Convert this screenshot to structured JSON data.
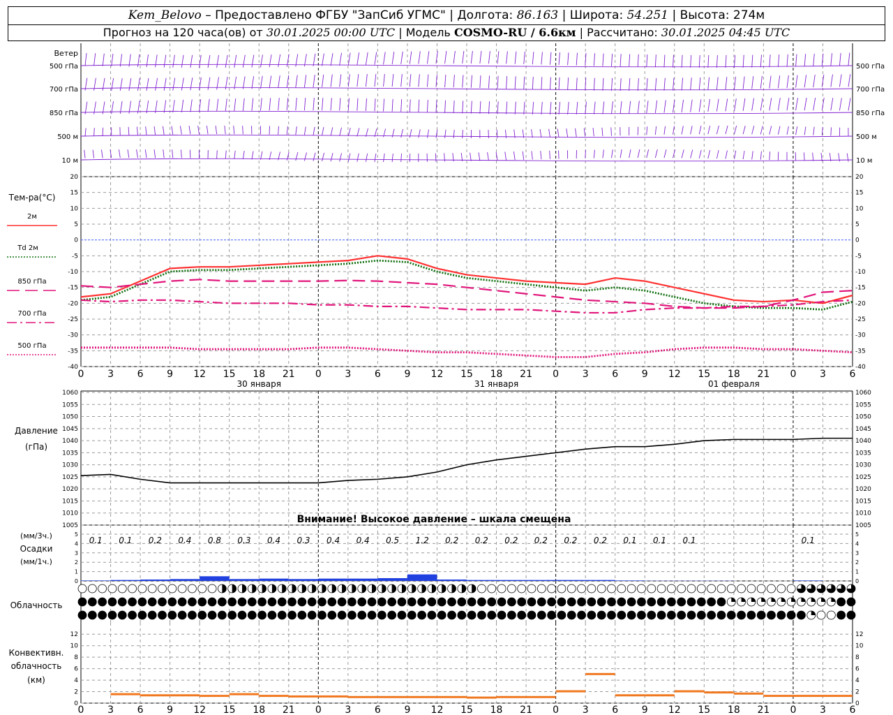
{
  "header": {
    "station": "Kem_Belovo",
    "provider": "– Предоставлено ФГБУ \"ЗапСиб УГМС\"",
    "lon_label": "Долгота:",
    "lon": "86.163",
    "lat_label": "Широта:",
    "lat": "54.251",
    "alt_label": "Высота:",
    "alt": "274м",
    "forecast_label": "Прогноз на 120 часа(ов) от",
    "forecast_time": "30.01.2025 00:00 UTC",
    "model_label": "Модель",
    "model": "COSMO-RU / 6.6км",
    "computed_label": "Рассчитано:",
    "computed_time": "30.01.2025 04:45 UTC",
    "sep": "|"
  },
  "time_axis": {
    "hours": [
      "0",
      "3",
      "6",
      "9",
      "12",
      "15",
      "18",
      "21",
      "0",
      "3",
      "6",
      "9",
      "12",
      "15",
      "18",
      "21",
      "0",
      "3",
      "6",
      "9",
      "12",
      "15",
      "18",
      "21",
      "0",
      "3",
      "6"
    ],
    "dates": [
      "30 января",
      "31 января",
      "01 февраля"
    ]
  },
  "wind_panel": {
    "title": "Ветер",
    "levels": [
      "500 гПа",
      "700 гПа",
      "850 гПа",
      "500 м",
      "10 м"
    ]
  },
  "temp_panel": {
    "title": "Тем-ра(°С)",
    "legend": [
      {
        "label": "2м",
        "color": "#ff3030",
        "dash": "solid"
      },
      {
        "label": "Td 2м",
        "color": "#107010",
        "dash": "dotted"
      },
      {
        "label": "850 гПа",
        "color": "#e0147a",
        "dash": "long-dash"
      },
      {
        "label": "700 гПа",
        "color": "#e0147a",
        "dash": "dash-dot"
      },
      {
        "label": "500 гПа",
        "color": "#e0147a",
        "dash": "dotted"
      }
    ],
    "ticks": [
      "20",
      "15",
      "10",
      "5",
      "0",
      "-5",
      "-10",
      "-15",
      "-20",
      "-25",
      "-30",
      "-35",
      "-40"
    ]
  },
  "pressure_panel": {
    "title": "Давление",
    "unit": "(гПа)",
    "ticks": [
      "1060",
      "1055",
      "1050",
      "1045",
      "1040",
      "1035",
      "1030",
      "1025",
      "1020",
      "1015",
      "1010",
      "1005"
    ],
    "warning": "Внимание! Высокое давление – шкала смещена"
  },
  "precip_panel": {
    "unit3": "(мм/3ч.)",
    "title": "Осадки",
    "unit1": "(мм/1ч.)",
    "ticks": [
      "5",
      "4",
      "3",
      "2",
      "1",
      "0"
    ],
    "labels": [
      "0.1",
      "0.1",
      "0.2",
      "0.4",
      "0.8",
      "0.3",
      "0.4",
      "0.3",
      "0.4",
      "0.4",
      "0.5",
      "1.2",
      "0.2",
      "0.2",
      "0.2",
      "0.2",
      "0.2",
      "0.2",
      "0.1",
      "0.1",
      "0.1",
      "",
      "",
      "",
      "0.1",
      "",
      ""
    ]
  },
  "cloud_panel": {
    "title": "Облачность"
  },
  "conv_panel": {
    "title1": "Конвективн.",
    "title2": "облачность",
    "unit": "(км)",
    "ticks": [
      "12",
      "10",
      "8",
      "6",
      "4",
      "2",
      "0"
    ]
  },
  "colors": {
    "wind": "#8020d0",
    "t2m": "#ff3030",
    "td": "#107010",
    "magenta": "#e0147a",
    "pressure": "#000000",
    "precip": "#2040e0",
    "conv": "#f07820",
    "grid": "#999999",
    "zero": "#4060ff"
  },
  "chart_data": [
    {
      "type": "line",
      "title": "Тем-ра(°С)",
      "x": [
        0,
        3,
        6,
        9,
        12,
        15,
        18,
        21,
        24,
        27,
        30,
        33,
        36,
        39,
        42,
        45,
        48,
        51,
        54,
        57,
        60,
        63,
        66,
        69,
        72,
        75,
        78
      ],
      "ylim": [
        -40,
        20
      ],
      "series": [
        {
          "name": "2м",
          "values": [
            -18,
            -17,
            -13,
            -9,
            -8.5,
            -8.5,
            -8,
            -7.5,
            -7,
            -6.5,
            -5,
            -6,
            -9,
            -11,
            -12,
            -13,
            -13.5,
            -14,
            -12,
            -13,
            -15,
            -17,
            -19,
            -19.5,
            -19,
            -20,
            -17.5
          ]
        },
        {
          "name": "Td 2м",
          "values": [
            -19,
            -18,
            -14,
            -10,
            -9.5,
            -9.5,
            -9,
            -8.5,
            -8,
            -7.5,
            -6.5,
            -7,
            -10,
            -12,
            -13,
            -14,
            -15,
            -16,
            -15,
            -16,
            -18,
            -20,
            -21,
            -21.5,
            -21.5,
            -22,
            -19.5
          ]
        },
        {
          "name": "850 гПа",
          "values": [
            -14.5,
            -15,
            -14,
            -13,
            -12.5,
            -13,
            -13,
            -13,
            -13,
            -12.8,
            -13,
            -13.5,
            -14,
            -15,
            -16,
            -17,
            -18,
            -19,
            -19.5,
            -20,
            -21,
            -21.5,
            -21.5,
            -21,
            -19,
            -16.5,
            -16
          ]
        },
        {
          "name": "700 гПа",
          "values": [
            -19,
            -19.5,
            -19,
            -19,
            -19.5,
            -20,
            -20,
            -20,
            -20.5,
            -20.5,
            -21,
            -21,
            -21.5,
            -22,
            -22,
            -22,
            -22.5,
            -23,
            -23,
            -22,
            -21.5,
            -21.5,
            -21,
            -21,
            -20.5,
            -19.5,
            -19
          ]
        },
        {
          "name": "500 гПа",
          "values": [
            -34,
            -34,
            -34,
            -34,
            -34.5,
            -34.5,
            -34.5,
            -34.5,
            -34,
            -34,
            -34.5,
            -35,
            -35.5,
            -35.5,
            -36,
            -36.5,
            -37,
            -37,
            -36,
            -35.5,
            -34.5,
            -34,
            -34,
            -34.5,
            -34.5,
            -35,
            -35.5
          ]
        }
      ]
    },
    {
      "type": "line",
      "title": "Давление",
      "x": [
        0,
        3,
        6,
        9,
        12,
        15,
        18,
        21,
        24,
        27,
        30,
        33,
        36,
        39,
        42,
        45,
        48,
        51,
        54,
        57,
        60,
        63,
        66,
        69,
        72,
        75,
        78
      ],
      "ylim": [
        1005,
        1060
      ],
      "series": [
        {
          "name": "Давление",
          "values": [
            1025.5,
            1026,
            1024,
            1022.5,
            1022.5,
            1022.5,
            1022.5,
            1022.5,
            1022.5,
            1023.5,
            1024,
            1025,
            1027,
            1030,
            1032,
            1033.5,
            1035,
            1036.5,
            1037.5,
            1037.5,
            1038.5,
            1040,
            1040.5,
            1040.5,
            1040.5,
            1041,
            1041
          ]
        }
      ]
    },
    {
      "type": "bar",
      "title": "Осадки",
      "x": [
        0,
        3,
        6,
        9,
        12,
        15,
        18,
        21,
        24,
        27,
        30,
        33,
        36,
        39,
        42,
        45,
        48,
        51,
        54,
        57,
        60,
        63,
        66,
        69,
        72,
        75,
        78
      ],
      "ylim": [
        0,
        5
      ],
      "values": [
        0.05,
        0.1,
        0.15,
        0.2,
        0.5,
        0.2,
        0.25,
        0.2,
        0.25,
        0.25,
        0.3,
        0.7,
        0.15,
        0.1,
        0.1,
        0.1,
        0.1,
        0.1,
        0.05,
        0.02,
        0.02,
        0.02,
        0,
        0,
        0.05,
        0,
        0
      ]
    },
    {
      "type": "bar",
      "title": "Конвективн. облачность",
      "x": [
        0,
        3,
        6,
        9,
        12,
        15,
        18,
        21,
        24,
        27,
        30,
        33,
        36,
        39,
        42,
        45,
        48,
        51,
        54,
        57,
        60,
        63,
        66,
        69,
        72,
        75,
        78
      ],
      "ylim": [
        0,
        13
      ],
      "values": [
        0,
        1.5,
        1.3,
        1.3,
        1.2,
        1.5,
        1.2,
        1.1,
        1.1,
        1.0,
        1.0,
        1.0,
        1.0,
        0.9,
        1.0,
        1.0,
        2.0,
        5.0,
        1.3,
        1.3,
        2.0,
        1.8,
        1.6,
        1.2,
        1.2,
        1.2,
        0
      ]
    }
  ]
}
